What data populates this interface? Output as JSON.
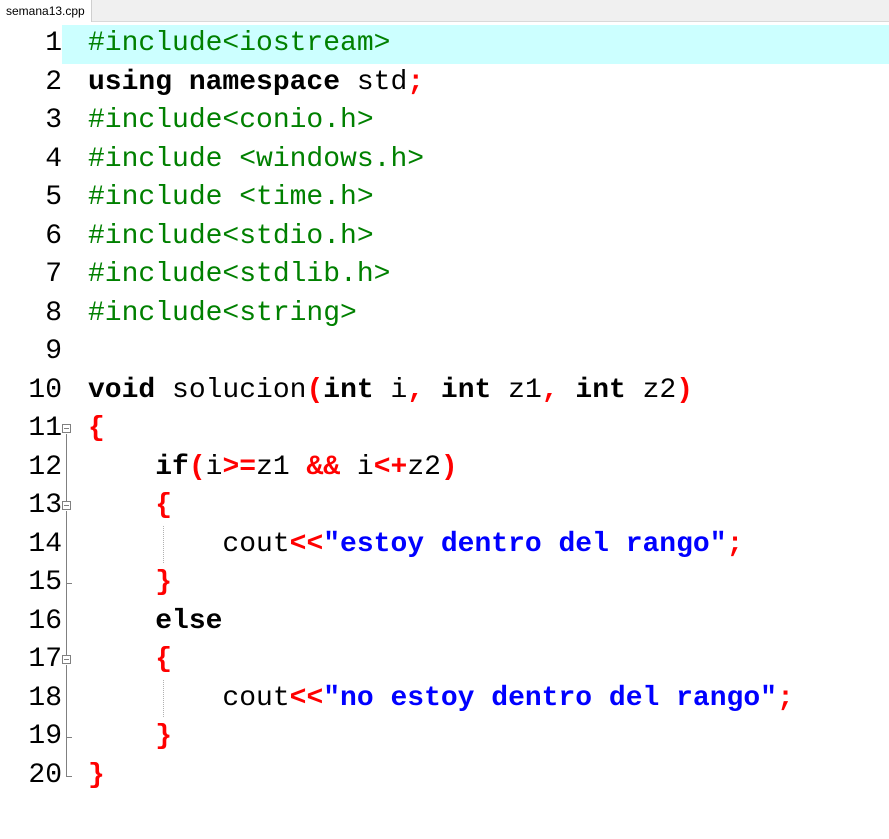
{
  "tab": {
    "filename": "semana13.cpp"
  },
  "editor": {
    "current_line": 1,
    "lines": [
      {
        "n": "1",
        "tokens": [
          {
            "t": "#include<iostream>",
            "c": "pp"
          }
        ]
      },
      {
        "n": "2",
        "tokens": [
          {
            "t": "using namespace",
            "c": "kw"
          },
          {
            "t": " std",
            "c": "id"
          },
          {
            "t": ";",
            "c": "op"
          }
        ]
      },
      {
        "n": "3",
        "tokens": [
          {
            "t": "#include<conio.h>",
            "c": "pp"
          }
        ]
      },
      {
        "n": "4",
        "tokens": [
          {
            "t": "#include <windows.h>",
            "c": "pp"
          }
        ]
      },
      {
        "n": "5",
        "tokens": [
          {
            "t": "#include <time.h>",
            "c": "pp"
          }
        ]
      },
      {
        "n": "6",
        "tokens": [
          {
            "t": "#include<stdio.h>",
            "c": "pp"
          }
        ]
      },
      {
        "n": "7",
        "tokens": [
          {
            "t": "#include<stdlib.h>",
            "c": "pp"
          }
        ]
      },
      {
        "n": "8",
        "tokens": [
          {
            "t": "#include<string>",
            "c": "pp"
          }
        ]
      },
      {
        "n": "9",
        "tokens": []
      },
      {
        "n": "10",
        "tokens": [
          {
            "t": "void",
            "c": "kw"
          },
          {
            "t": " solucion",
            "c": "id"
          },
          {
            "t": "(",
            "c": "op"
          },
          {
            "t": "int",
            "c": "kw"
          },
          {
            "t": " i",
            "c": "id"
          },
          {
            "t": ",",
            "c": "op"
          },
          {
            "t": " ",
            "c": "id"
          },
          {
            "t": "int",
            "c": "kw"
          },
          {
            "t": " z1",
            "c": "id"
          },
          {
            "t": ",",
            "c": "op"
          },
          {
            "t": " ",
            "c": "id"
          },
          {
            "t": "int",
            "c": "kw"
          },
          {
            "t": " z2",
            "c": "id"
          },
          {
            "t": ")",
            "c": "op"
          }
        ]
      },
      {
        "n": "11",
        "tokens": [
          {
            "t": "{",
            "c": "op"
          }
        ]
      },
      {
        "n": "12",
        "tokens": [
          {
            "t": "    ",
            "c": "id"
          },
          {
            "t": "if",
            "c": "kw"
          },
          {
            "t": "(",
            "c": "op"
          },
          {
            "t": "i",
            "c": "id"
          },
          {
            "t": ">=",
            "c": "op"
          },
          {
            "t": "z1 ",
            "c": "id"
          },
          {
            "t": "&&",
            "c": "op"
          },
          {
            "t": " i",
            "c": "id"
          },
          {
            "t": "<+",
            "c": "op"
          },
          {
            "t": "z2",
            "c": "id"
          },
          {
            "t": ")",
            "c": "op"
          }
        ]
      },
      {
        "n": "13",
        "tokens": [
          {
            "t": "    ",
            "c": "id"
          },
          {
            "t": "{",
            "c": "op"
          }
        ]
      },
      {
        "n": "14",
        "tokens": [
          {
            "t": "        cout",
            "c": "id"
          },
          {
            "t": "<<",
            "c": "op"
          },
          {
            "t": "\"estoy dentro del rango\"",
            "c": "str"
          },
          {
            "t": ";",
            "c": "op"
          }
        ]
      },
      {
        "n": "15",
        "tokens": [
          {
            "t": "    ",
            "c": "id"
          },
          {
            "t": "}",
            "c": "op"
          }
        ]
      },
      {
        "n": "16",
        "tokens": [
          {
            "t": "    ",
            "c": "id"
          },
          {
            "t": "else",
            "c": "kw"
          }
        ]
      },
      {
        "n": "17",
        "tokens": [
          {
            "t": "    ",
            "c": "id"
          },
          {
            "t": "{",
            "c": "op"
          }
        ]
      },
      {
        "n": "18",
        "tokens": [
          {
            "t": "        cout",
            "c": "id"
          },
          {
            "t": "<<",
            "c": "op"
          },
          {
            "t": "\"no estoy dentro del rango\"",
            "c": "str"
          },
          {
            "t": ";",
            "c": "op"
          }
        ]
      },
      {
        "n": "19",
        "tokens": [
          {
            "t": "    ",
            "c": "id"
          },
          {
            "t": "}",
            "c": "op"
          }
        ]
      },
      {
        "n": "20",
        "tokens": [
          {
            "t": "}",
            "c": "op"
          }
        ]
      }
    ]
  },
  "colors": {
    "keyword": "#000000",
    "preprocessor": "#008000",
    "operator": "#ff0000",
    "string": "#0000ff",
    "current_line_bg": "#ccffff"
  },
  "icons": {
    "fold": "fold-minus-icon"
  }
}
